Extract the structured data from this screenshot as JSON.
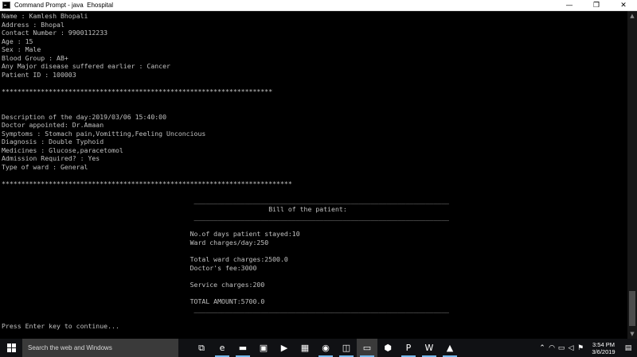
{
  "window": {
    "title": "Command Prompt - java  Ehospital",
    "minimize_glyph": "—",
    "maximize_glyph": "❐",
    "close_glyph": "✕"
  },
  "console": {
    "lines": [
      "Name : Kamlesh Bhopali",
      "Address : Bhopal",
      "Contact Number : 9900112233",
      "Age : 15",
      "Sex : Male",
      "Blood Group : AB+",
      "Any Major disease suffered earlier : Cancer",
      "Patient ID : 100003",
      "",
      "*********************************************************************",
      "",
      "",
      "Description of the day:2019/03/06 15:40:00",
      "Doctor appointed: Dr.Amaan",
      "Symptoms : Stomach pain,Vomitting,Feeling Unconcious",
      "Diagnosis : Double Typhoid",
      "Medicines : Glucose,paracetomol",
      "Admission Required? : Yes",
      "Type of ward : General",
      "",
      "**************************************************************************",
      "",
      "                                                 _________________________________________________________________",
      "                                                                    Bill of the patient:",
      "                                                 _________________________________________________________________",
      "",
      "                                                No.of days patient stayed:10",
      "                                                Ward charges/day:250",
      "",
      "                                                Total ward charges:2500.0",
      "                                                Doctor's fee:3000",
      "",
      "                                                Service charges:200",
      "",
      "                                                TOTAL AMOUNT:5700.0",
      "                                                 _________________________________________________________________",
      "",
      "Press Enter key to continue..."
    ]
  },
  "taskbar": {
    "search_placeholder": "Search the web and Windows",
    "apps": [
      {
        "icon": "task-view-icon",
        "glyph": "⧉"
      },
      {
        "icon": "edge-icon",
        "glyph": "e"
      },
      {
        "icon": "file-explorer-icon",
        "glyph": "▬"
      },
      {
        "icon": "store-icon",
        "glyph": "▣"
      },
      {
        "icon": "video-player-icon",
        "glyph": "▶"
      },
      {
        "icon": "calculator-icon",
        "glyph": "▦"
      },
      {
        "icon": "chrome-icon",
        "glyph": "◉"
      },
      {
        "icon": "screen-capture-icon",
        "glyph": "◫"
      },
      {
        "icon": "command-prompt-icon",
        "glyph": "▭"
      },
      {
        "icon": "virtualbox-icon",
        "glyph": "⬢"
      },
      {
        "icon": "powerpoint-icon",
        "glyph": "P"
      },
      {
        "icon": "word-icon",
        "glyph": "W"
      },
      {
        "icon": "photos-icon",
        "glyph": "▲"
      }
    ],
    "tray_icons": [
      {
        "icon": "chevron-up-icon",
        "glyph": "⌃"
      },
      {
        "icon": "wifi-icon",
        "glyph": "◠"
      },
      {
        "icon": "network-icon",
        "glyph": "▭"
      },
      {
        "icon": "volume-icon",
        "glyph": "◁"
      },
      {
        "icon": "action-flag-icon",
        "glyph": "⚑"
      }
    ],
    "time": "3:54 PM",
    "date": "3/6/2019",
    "notification_glyph": "▤"
  },
  "colors": {
    "console_text": "#c0c0c0",
    "console_bg": "#000000",
    "taskbar_bg": "#101114",
    "active_indicator": "#76b9ed"
  }
}
